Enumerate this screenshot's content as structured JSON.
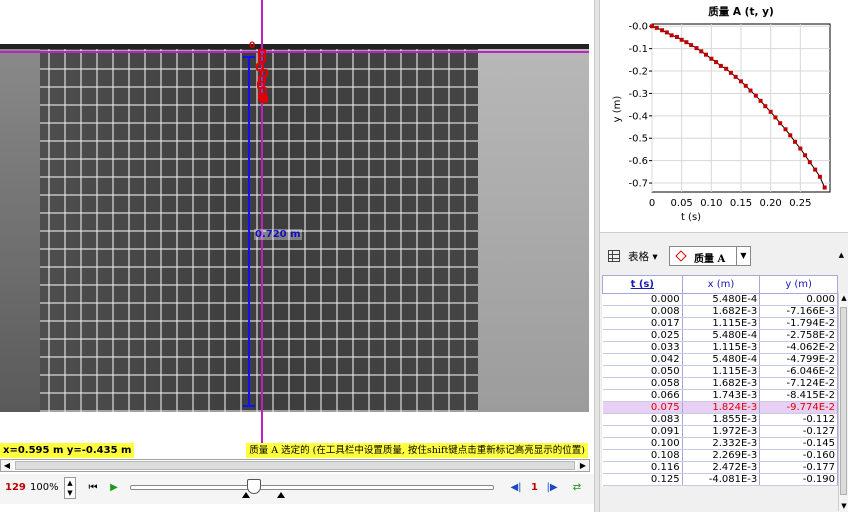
{
  "video": {
    "tape_length": "0.720 m",
    "coordinate_readout": "x=0.595 m  y=-0.435 m",
    "hint": "质量 A 选定的 (在工具栏中设置质量, 按住shift键点击重新标记高亮显示的位置)",
    "origin_mark": "0"
  },
  "player": {
    "frame": "129",
    "zoom": "100%",
    "step_size": "1"
  },
  "chart_data": {
    "type": "scatter",
    "title": "质量 A (t, y)",
    "xlabel": "t (s)",
    "ylabel": "y (m)",
    "xlim": [
      0,
      0.3
    ],
    "ylim": [
      -0.74,
      0.01
    ],
    "xticks": [
      0,
      0.05,
      0.1,
      0.15,
      0.2,
      0.25
    ],
    "yticks": [
      0.0,
      -0.1,
      -0.2,
      -0.3,
      -0.4,
      -0.5,
      -0.6,
      -0.7
    ],
    "xtick_labels": [
      "0",
      "0.05",
      "0.10",
      "0.15",
      "0.20",
      "0.25"
    ],
    "ytick_labels": [
      "-0.0",
      "-0.1",
      "-0.2",
      "-0.3",
      "-0.4",
      "-0.5",
      "-0.6",
      "-0.7"
    ],
    "grid": true,
    "series": [
      {
        "x": [
          0,
          0.008,
          0.017,
          0.025,
          0.033,
          0.042,
          0.05,
          0.058,
          0.066,
          0.075,
          0.083,
          0.091,
          0.1,
          0.108,
          0.116,
          0.125,
          0.133,
          0.141,
          0.15,
          0.158,
          0.166,
          0.175,
          0.183,
          0.191,
          0.2,
          0.208,
          0.216,
          0.225,
          0.233,
          0.241,
          0.25,
          0.258,
          0.266,
          0.275,
          0.283,
          0.291
        ],
        "y": [
          0,
          -0.0072,
          -0.0179,
          -0.0276,
          -0.0406,
          -0.048,
          -0.0605,
          -0.0712,
          -0.0842,
          -0.0977,
          -0.112,
          -0.127,
          -0.145,
          -0.16,
          -0.177,
          -0.19,
          -0.208,
          -0.226,
          -0.246,
          -0.266,
          -0.287,
          -0.31,
          -0.333,
          -0.357,
          -0.382,
          -0.407,
          -0.433,
          -0.46,
          -0.487,
          -0.516,
          -0.546,
          -0.576,
          -0.607,
          -0.64,
          -0.672,
          -0.72
        ]
      }
    ]
  },
  "table": {
    "menu_label": "表格",
    "mass_label": "质量 A",
    "headers": [
      "t (s)",
      "x (m)",
      "y (m)"
    ],
    "rows": [
      [
        "0.000",
        "5.480E-4",
        "0.000"
      ],
      [
        "0.008",
        "1.682E-3",
        "-7.166E-3"
      ],
      [
        "0.017",
        "1.115E-3",
        "-1.794E-2"
      ],
      [
        "0.025",
        "5.480E-4",
        "-2.758E-2"
      ],
      [
        "0.033",
        "1.115E-3",
        "-4.062E-2"
      ],
      [
        "0.042",
        "5.480E-4",
        "-4.799E-2"
      ],
      [
        "0.050",
        "1.115E-3",
        "-6.046E-2"
      ],
      [
        "0.058",
        "1.682E-3",
        "-7.124E-2"
      ],
      [
        "0.066",
        "1.743E-3",
        "-8.415E-2"
      ],
      [
        "0.075",
        "1.824E-3",
        "-9.774E-2"
      ],
      [
        "0.083",
        "1.855E-3",
        "-0.112"
      ],
      [
        "0.091",
        "1.972E-3",
        "-0.127"
      ],
      [
        "0.100",
        "2.332E-3",
        "-0.145"
      ],
      [
        "0.108",
        "2.269E-3",
        "-0.160"
      ],
      [
        "0.116",
        "2.472E-3",
        "-0.177"
      ],
      [
        "0.125",
        "-4.081E-3",
        "-0.190"
      ]
    ],
    "highlight_row": 9
  },
  "colors": {
    "accent_red": "#e00000",
    "axis_magenta": "#c020c0",
    "tape_blue": "#1010ff",
    "highlight_yellow": "#ffff40"
  }
}
